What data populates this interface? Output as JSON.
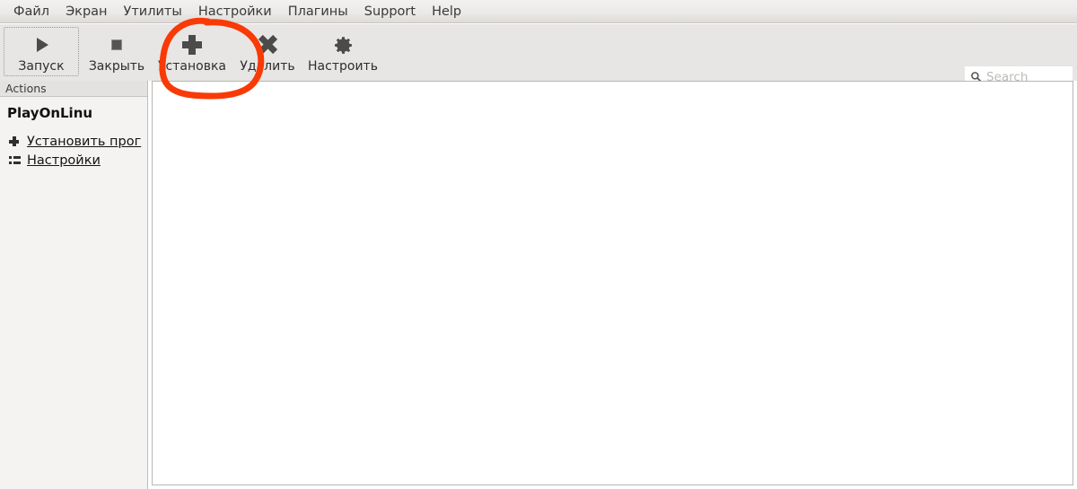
{
  "window": {
    "app_name": "PlayOnLinux"
  },
  "menubar": {
    "items": [
      {
        "label": "Файл",
        "name": "menu-file"
      },
      {
        "label": "Экран",
        "name": "menu-display"
      },
      {
        "label": "Утилиты",
        "name": "menu-utilities"
      },
      {
        "label": "Настройки",
        "name": "menu-settings"
      },
      {
        "label": "Плагины",
        "name": "menu-plugins"
      },
      {
        "label": "Support",
        "name": "menu-support"
      },
      {
        "label": "Help",
        "name": "menu-help"
      }
    ]
  },
  "toolbar": {
    "buttons": [
      {
        "label": "Запуск",
        "icon": "play-icon",
        "focused": true
      },
      {
        "label": "Закрыть",
        "icon": "stop-icon",
        "focused": false
      },
      {
        "label": "Установка",
        "icon": "plus-icon",
        "focused": false
      },
      {
        "label": "Удалить",
        "icon": "close-icon",
        "focused": false
      },
      {
        "label": "Настроить",
        "icon": "gear-icon",
        "focused": false
      }
    ],
    "search": {
      "placeholder": "Search",
      "value": "",
      "icon": "search-icon"
    }
  },
  "sidebar": {
    "header": "Actions",
    "title": "PlayOnLinu",
    "links": [
      {
        "label": "Установить прог",
        "icon": "plus-icon"
      },
      {
        "label": "Настройки",
        "icon": "list-icon"
      }
    ]
  },
  "main": {
    "content": ""
  },
  "annotation": {
    "type": "hand-drawn-ellipse",
    "color": "#f93a06",
    "target": "Установка"
  }
}
